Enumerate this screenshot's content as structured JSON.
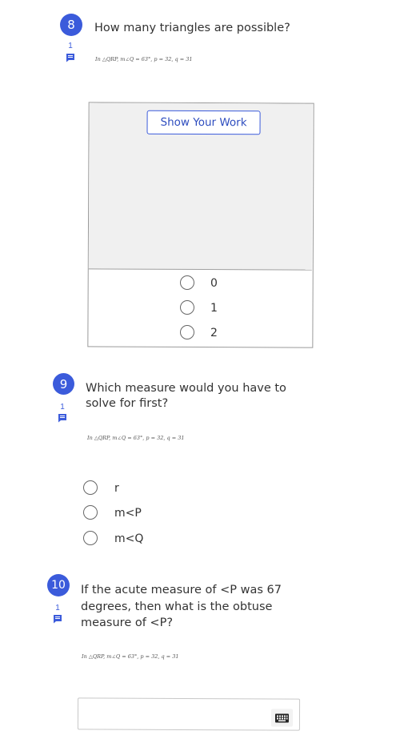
{
  "questions": [
    {
      "number": "8",
      "comment_count": "1",
      "text": "How many triangles are possible?",
      "formula": "In △QRP, m∠Q = 63°, p = 32, q = 31",
      "show_work_label": "Show Your Work",
      "options": [
        "0",
        "1",
        "2"
      ]
    },
    {
      "number": "9",
      "comment_count": "1",
      "text_line1": "Which measure would you have to",
      "text_line2": "solve for first?",
      "formula": "In △QRP, m∠Q = 63°, p = 32, q = 31",
      "options": [
        "r",
        "m<P",
        "m<Q"
      ]
    },
    {
      "number": "10",
      "comment_count": "1",
      "text_line1": "If the acute measure of <P was 67",
      "text_line2": "degrees, then what is the obtuse",
      "text_line3": "measure of <P?",
      "formula": "In △QRP, m∠Q = 63°, p = 32, q = 31",
      "answer_value": ""
    }
  ],
  "icons": {
    "comment": "comment-icon",
    "keyboard": "keyboard-icon"
  },
  "colors": {
    "accent": "#3b5bdb",
    "work_area_bg": "#f0f0f0"
  }
}
